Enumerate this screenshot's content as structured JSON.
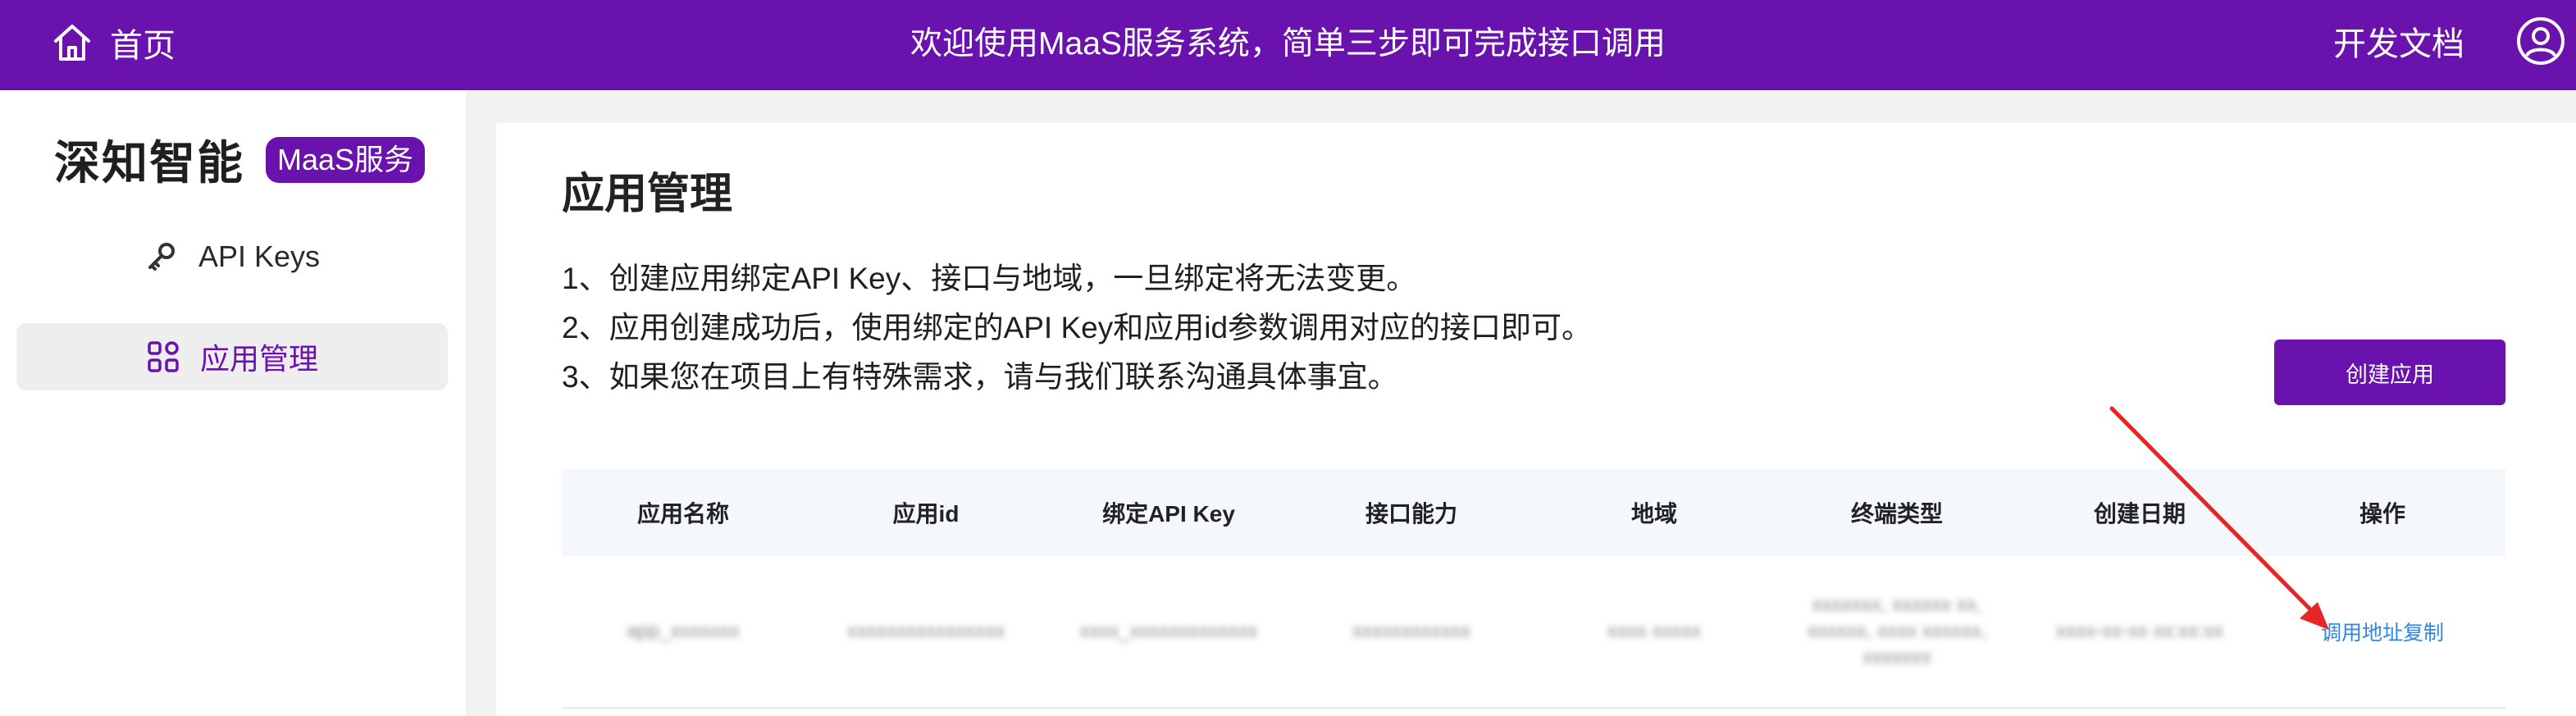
{
  "colors": {
    "brand": "#6a12ae",
    "link": "#2e86e6",
    "arrow": "#e82525"
  },
  "topbar": {
    "home_label": "首页",
    "welcome": "欢迎使用MaaS服务系统，简单三步即可完成接口调用",
    "docs_label": "开发文档"
  },
  "sidebar": {
    "brand_name": "深知智能",
    "brand_badge": "MaaS服务",
    "items": [
      {
        "label": "API Keys",
        "icon": "key-icon"
      },
      {
        "label": "应用管理",
        "icon": "grid-icon",
        "active": true
      }
    ]
  },
  "main": {
    "title": "应用管理",
    "notes": [
      "1、创建应用绑定API Key、接口与地域，一旦绑定将无法变更。",
      "2、应用创建成功后，使用绑定的API Key和应用id参数调用对应的接口即可。",
      "3、如果您在项目上有特殊需求，请与我们联系沟通具体事宜。"
    ],
    "create_button": "创建应用",
    "table": {
      "headers": [
        "应用名称",
        "应用id",
        "绑定API Key",
        "接口能力",
        "地域",
        "终端类型",
        "创建日期",
        "操作"
      ],
      "rows": [
        {
          "cells": [
            "app_xxxxxxx",
            "xxxxxxxxxxxxxxxx",
            "xxxx_xxxxxxxxxxxxx",
            "xxxxxxxxxxxx",
            "xxxx xxxxx",
            "xxxxxxx, xxxxxx xx, xxxxxx, xxxx xxxxxx, xxxxxxx",
            "xxxx-xx-xx xx:xx:xx",
            ""
          ],
          "action": "调用地址复制"
        }
      ]
    }
  }
}
